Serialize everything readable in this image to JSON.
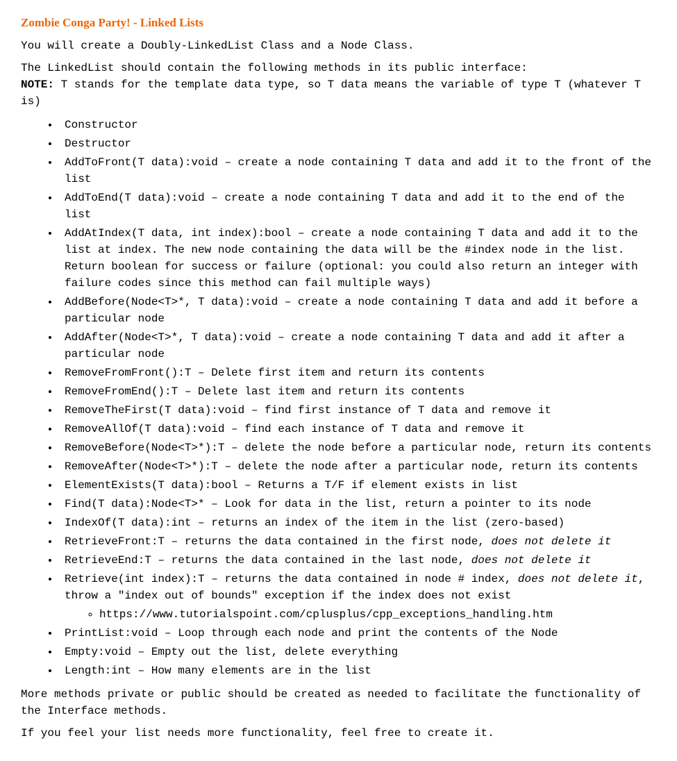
{
  "title": "Zombie Conga Party! - Linked Lists",
  "intro1": "You will create a Doubly-LinkedList Class and a Node Class.",
  "intro2": "The LinkedList should contain the following methods in its public interface:",
  "note_label": "NOTE:",
  "note_text": " T stands for the template data type, so T data means the variable of type T (whatever T is)",
  "methods": {
    "m0": "Constructor",
    "m1": "Destructor",
    "m2": "AddToFront(T data):void – create a node containing T data and add it to the front of the list",
    "m3": "AddToEnd(T data):void – create a node containing T data and add it to the end of the list",
    "m4": "AddAtIndex(T data, int index):bool – create a node containing T data and add it to the list at index.  The new node containing the data will be the #index node in the list. Return boolean for success or failure (optional: you could also return an integer with failure codes since this method can fail multiple ways)",
    "m5": "AddBefore(Node<T>*, T data):void – create a node containing T data and add it before a particular node",
    "m6": "AddAfter(Node<T>*, T data):void – create a node containing T data and add it after a particular node",
    "m7": "RemoveFromFront():T – Delete first item and return its contents",
    "m8": "RemoveFromEnd():T – Delete last item and return its contents",
    "m9": "RemoveTheFirst(T data):void – find first instance of T data and remove it",
    "m10": "RemoveAllOf(T data):void – find each instance of T data and remove it",
    "m11": "RemoveBefore(Node<T>*):T – delete the node before a particular node, return its contents",
    "m12": "RemoveAfter(Node<T>*):T – delete the node after a particular node, return its contents",
    "m13": "ElementExists(T data):bool – Returns a T/F if element exists in list",
    "m14": "Find(T data):Node<T>* – Look for data in the list, return a pointer to its node",
    "m15": "IndexOf(T data):int – returns an index of the item in the list (zero-based)",
    "m16a": "RetrieveFront:T – returns the data contained in the first node, ",
    "m16b": "does not delete it",
    "m17a": "RetrieveEnd:T – returns the data contained in the last node, ",
    "m17b": "does not delete it",
    "m18a": "Retrieve(int index):T – returns the data contained in node # index, ",
    "m18b": "does not delete it",
    "m18c": ", throw a \"index out of bounds\" exception if the index does not exist",
    "m18_sub": "https://www.tutorialspoint.com/cplusplus/cpp_exceptions_handling.htm",
    "m19": "PrintList:void – Loop through each node and print the contents of the Node",
    "m20": "Empty:void – Empty out the list, delete everything",
    "m21": "Length:int – How many elements are in the list"
  },
  "outro1": "More methods private or public should be created as needed to facilitate the functionality of the Interface methods.",
  "outro2": "If you feel your list needs more functionality, feel free to create it."
}
